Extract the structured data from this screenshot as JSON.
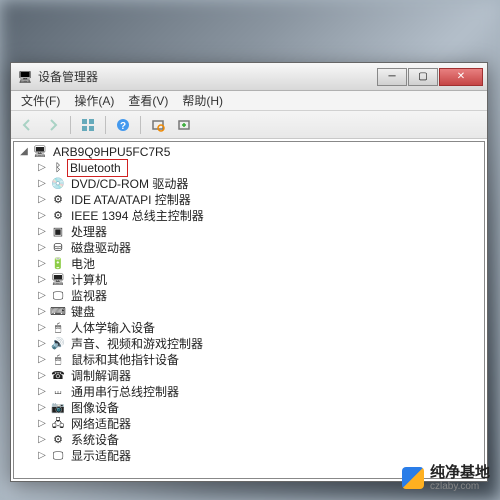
{
  "window": {
    "title": "设备管理器",
    "controls": {
      "minimize": "─",
      "maximize": "▢",
      "close": "✕"
    }
  },
  "menubar": {
    "items": [
      {
        "label": "文件(F)"
      },
      {
        "label": "操作(A)"
      },
      {
        "label": "查看(V)"
      },
      {
        "label": "帮助(H)"
      }
    ]
  },
  "tree": {
    "root": {
      "label": "ARB9Q9HPU5FC7R5",
      "icon": "computer-icon",
      "expanded": true
    },
    "highlighted_index": 0,
    "children": [
      {
        "label": "Bluetooth",
        "icon": "bluetooth-icon"
      },
      {
        "label": "DVD/CD-ROM 驱动器",
        "icon": "disc-icon"
      },
      {
        "label": "IDE ATA/ATAPI 控制器",
        "icon": "controller-icon"
      },
      {
        "label": "IEEE 1394 总线主控制器",
        "icon": "controller-icon"
      },
      {
        "label": "处理器",
        "icon": "processor-icon"
      },
      {
        "label": "磁盘驱动器",
        "icon": "disk-icon"
      },
      {
        "label": "电池",
        "icon": "battery-icon"
      },
      {
        "label": "计算机",
        "icon": "computer-icon"
      },
      {
        "label": "监视器",
        "icon": "monitor-icon"
      },
      {
        "label": "键盘",
        "icon": "keyboard-icon"
      },
      {
        "label": "人体学输入设备",
        "icon": "hid-icon"
      },
      {
        "label": "声音、视频和游戏控制器",
        "icon": "sound-icon"
      },
      {
        "label": "鼠标和其他指针设备",
        "icon": "mouse-icon"
      },
      {
        "label": "调制解调器",
        "icon": "modem-icon"
      },
      {
        "label": "通用串行总线控制器",
        "icon": "usb-icon"
      },
      {
        "label": "图像设备",
        "icon": "imaging-icon"
      },
      {
        "label": "网络适配器",
        "icon": "network-icon"
      },
      {
        "label": "系统设备",
        "icon": "system-icon"
      },
      {
        "label": "显示适配器",
        "icon": "display-icon"
      }
    ]
  },
  "icons": {
    "computer-icon": "🖥",
    "bluetooth-icon": "ᛒ",
    "disc-icon": "💿",
    "controller-icon": "⚙",
    "processor-icon": "▣",
    "disk-icon": "⛁",
    "battery-icon": "🔋",
    "monitor-icon": "🖵",
    "keyboard-icon": "⌨",
    "hid-icon": "🖱",
    "sound-icon": "🔊",
    "mouse-icon": "🖱",
    "modem-icon": "☎",
    "usb-icon": "⏙",
    "imaging-icon": "📷",
    "network-icon": "🖧",
    "system-icon": "⚙",
    "display-icon": "🖵"
  },
  "watermark": {
    "title": "纯净基地",
    "url": "czlaby.com"
  }
}
